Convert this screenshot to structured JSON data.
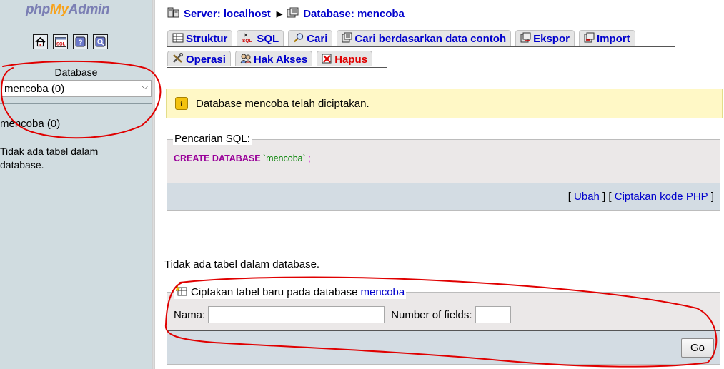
{
  "sidebar": {
    "logo": {
      "php": "php",
      "my": "My",
      "admin": "Admin"
    },
    "icons": [
      "home-icon",
      "sql-query-window-icon",
      "documentation-icon",
      "help-icon"
    ],
    "database_label": "Database",
    "database_select_value": "mencoba (0)",
    "current_db": "mencoba (0)",
    "no_tables_text": "Tidak ada tabel dalam database."
  },
  "breadcrumb": {
    "server": "Server: localhost",
    "database": "Database: mencoba"
  },
  "tabs": [
    {
      "label": "Struktur",
      "icon": "structure-icon"
    },
    {
      "label": "SQL",
      "icon": "sql-icon"
    },
    {
      "label": "Cari",
      "icon": "search-icon"
    },
    {
      "label": "Cari berdasarkan data contoh",
      "icon": "query-by-example-icon"
    },
    {
      "label": "Ekspor",
      "icon": "export-icon"
    },
    {
      "label": "Import",
      "icon": "import-icon"
    },
    {
      "label": "Operasi",
      "icon": "operations-icon"
    },
    {
      "label": "Hak Akses",
      "icon": "privileges-icon"
    },
    {
      "label": "Hapus",
      "icon": "drop-icon"
    }
  ],
  "notice": {
    "icon": "notice-icon",
    "message": "Database mencoba telah diciptakan."
  },
  "sql_box": {
    "legend": "Pencarian SQL:",
    "keyword": "CREATE DATABASE",
    "identifier": "`mencoba`",
    "terminator": ";",
    "links": {
      "open": "[",
      "edit": "Ubah",
      "mid": "] [",
      "php": "Ciptakan kode PHP",
      "close": "]"
    }
  },
  "no_tables_message": "Tidak ada tabel dalam database.",
  "create_table": {
    "legend_text": "Ciptakan tabel baru pada database",
    "legend_db": "mencoba",
    "name_label": "Nama:",
    "name_value": "",
    "fields_label": "Number of fields:",
    "fields_value": "",
    "go_label": "Go"
  },
  "colors": {
    "sidebar_bg": "#d0dce0",
    "link": "#0000cc",
    "notice_bg": "#fff8c6",
    "annotation": "#e00000"
  }
}
